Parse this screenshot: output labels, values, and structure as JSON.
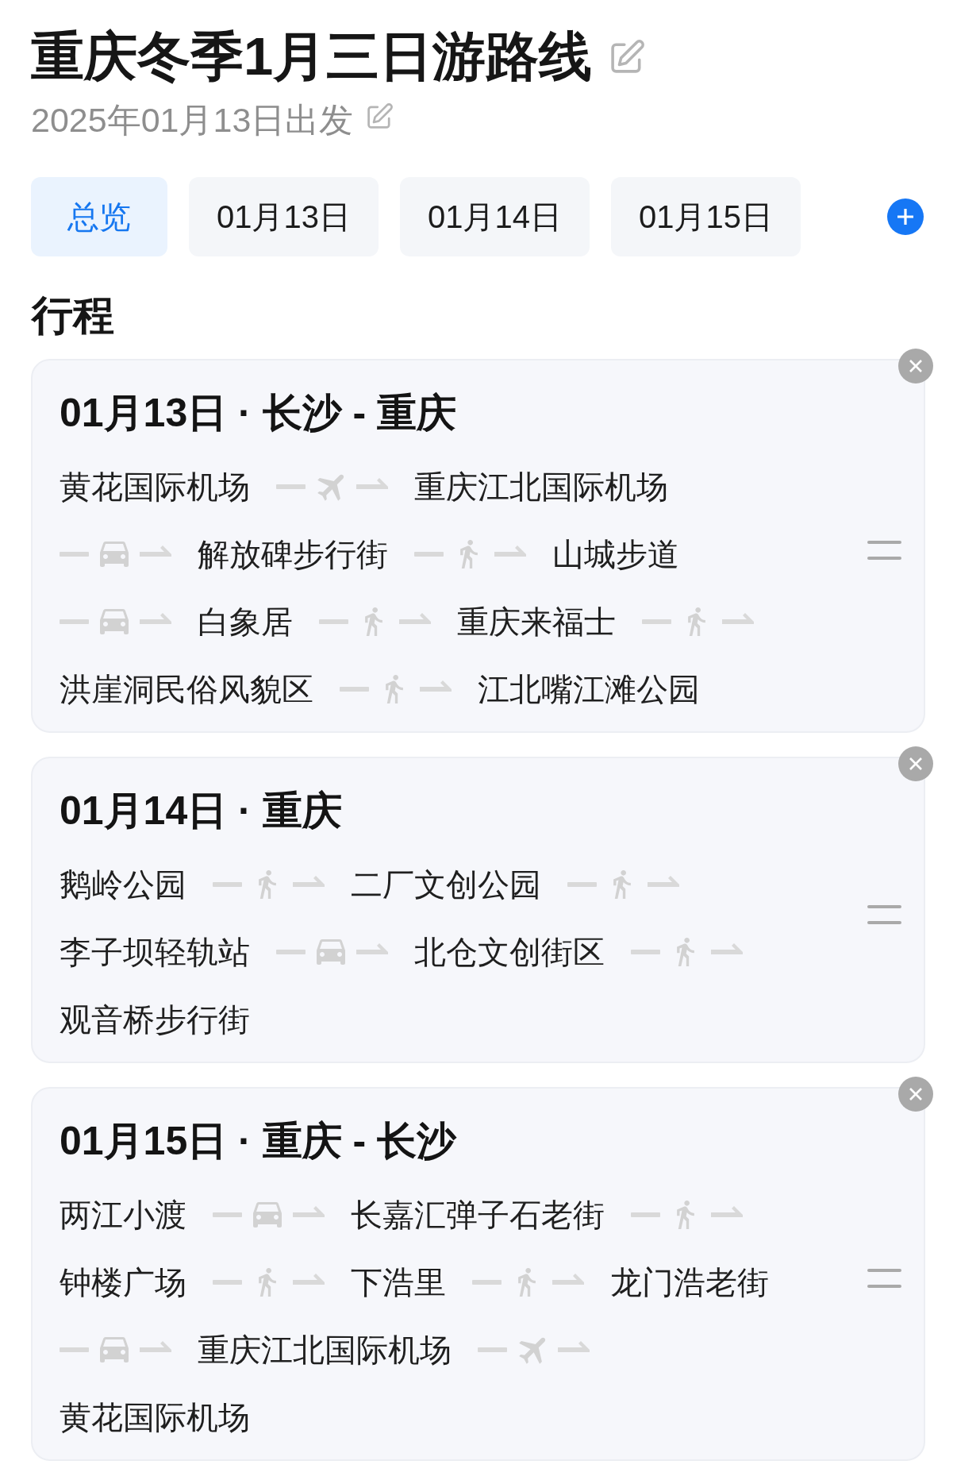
{
  "header": {
    "title": "重庆冬季1月三日游路线",
    "departure": "2025年01月13日出发"
  },
  "tabs": [
    {
      "label": "总览",
      "selected": true
    },
    {
      "label": "01月13日",
      "selected": false
    },
    {
      "label": "01月14日",
      "selected": false
    },
    {
      "label": "01月15日",
      "selected": false
    }
  ],
  "section_title": "行程",
  "days": [
    {
      "title": "01月13日 · 长沙 - 重庆",
      "route": [
        {
          "kind": "stop",
          "name": "黄花国际机场"
        },
        {
          "kind": "flight"
        },
        {
          "kind": "stop",
          "name": "重庆江北国际机场"
        },
        {
          "kind": "car"
        },
        {
          "kind": "stop",
          "name": "解放碑步行街"
        },
        {
          "kind": "walk"
        },
        {
          "kind": "stop",
          "name": "山城步道"
        },
        {
          "kind": "car"
        },
        {
          "kind": "stop",
          "name": "白象居"
        },
        {
          "kind": "walk"
        },
        {
          "kind": "stop",
          "name": "重庆来福士"
        },
        {
          "kind": "walk"
        },
        {
          "kind": "stop",
          "name": "洪崖洞民俗风貌区"
        },
        {
          "kind": "walk"
        },
        {
          "kind": "stop",
          "name": "江北嘴江滩公园"
        }
      ]
    },
    {
      "title": "01月14日 · 重庆",
      "route": [
        {
          "kind": "stop",
          "name": "鹅岭公园"
        },
        {
          "kind": "walk"
        },
        {
          "kind": "stop",
          "name": "二厂文创公园"
        },
        {
          "kind": "walk"
        },
        {
          "kind": "stop",
          "name": "李子坝轻轨站"
        },
        {
          "kind": "car"
        },
        {
          "kind": "stop",
          "name": "北仓文创街区"
        },
        {
          "kind": "walk"
        },
        {
          "kind": "stop",
          "name": "观音桥步行街"
        }
      ]
    },
    {
      "title": "01月15日 · 重庆 - 长沙",
      "route": [
        {
          "kind": "stop",
          "name": "两江小渡"
        },
        {
          "kind": "car"
        },
        {
          "kind": "stop",
          "name": "长嘉汇弹子石老街"
        },
        {
          "kind": "walk"
        },
        {
          "kind": "stop",
          "name": "钟楼广场"
        },
        {
          "kind": "walk"
        },
        {
          "kind": "stop",
          "name": "下浩里"
        },
        {
          "kind": "walk"
        },
        {
          "kind": "stop",
          "name": "龙门浩老街"
        },
        {
          "kind": "car"
        },
        {
          "kind": "stop",
          "name": "重庆江北国际机场"
        },
        {
          "kind": "flight"
        },
        {
          "kind": "stop",
          "name": "黄花国际机场"
        }
      ]
    }
  ]
}
